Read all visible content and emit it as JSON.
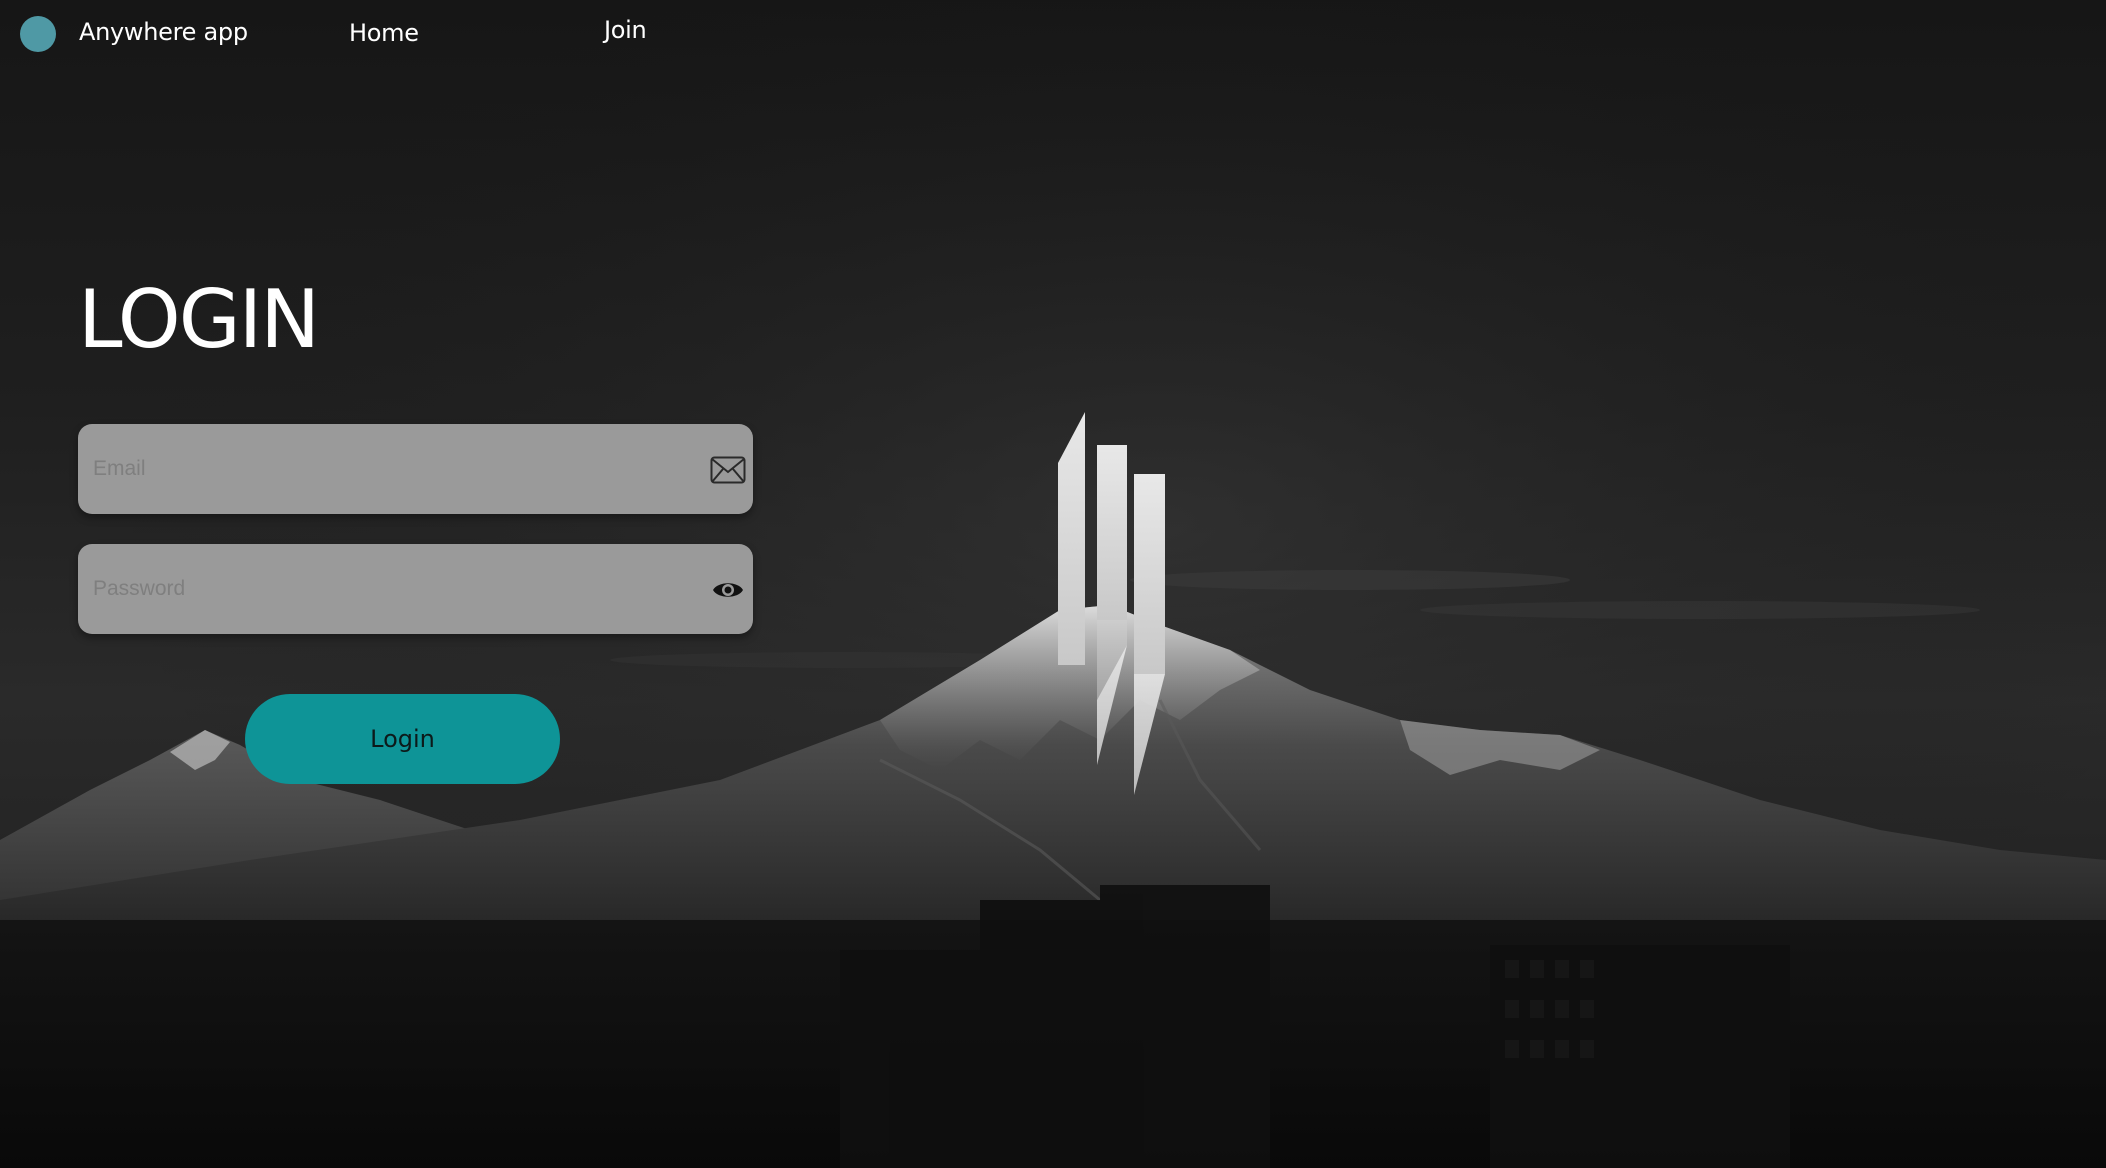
{
  "nav": {
    "brand": "Anywhere app",
    "links": [
      "Home",
      "Join"
    ]
  },
  "login": {
    "title": "LOGIN",
    "email_placeholder": "Email",
    "password_placeholder": "Password",
    "button_label": "Login"
  },
  "icons": {
    "nav_logo": "circle-logo-icon",
    "email": "envelope-icon",
    "password": "eye-icon",
    "center_logo": "vertical-bars-logo-icon"
  },
  "colors": {
    "accent": "#0e9497",
    "nav_dot": "#4f99a5",
    "field_bg": "#9a9a9a",
    "background": "#1b1b1b"
  }
}
